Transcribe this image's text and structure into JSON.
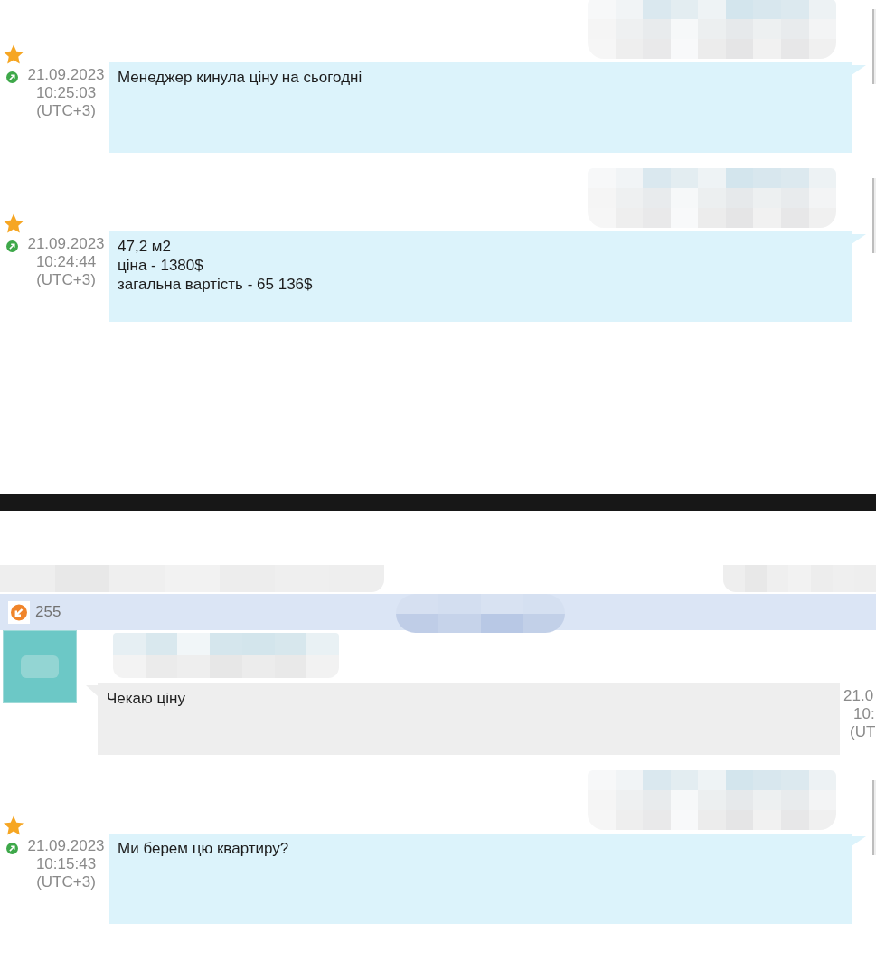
{
  "screens": [
    {
      "messages": [
        {
          "kind": "outgoing",
          "starred": true,
          "date": "21.09.2023",
          "time": "10:25:03",
          "timezone": "(UTC+3)",
          "text": "Менеджер кинула ціну на сьогодні"
        },
        {
          "kind": "outgoing",
          "starred": true,
          "date": "21.09.2023",
          "time": "10:24:44",
          "timezone": "(UTC+3)",
          "text": "47,2 м2\nціна - 1380$\nзагальна вартість - 65 136$"
        }
      ]
    },
    {
      "header": {
        "label": "255"
      },
      "messages": [
        {
          "kind": "incoming",
          "date": "21.0",
          "time": "10:",
          "timezone": "(UT",
          "text": "Чекаю ціну"
        },
        {
          "kind": "outgoing",
          "starred": true,
          "date": "21.09.2023",
          "time": "10:15:43",
          "timezone": "(UTC+3)",
          "text": "Ми берем цю квартиру?"
        }
      ]
    }
  ]
}
